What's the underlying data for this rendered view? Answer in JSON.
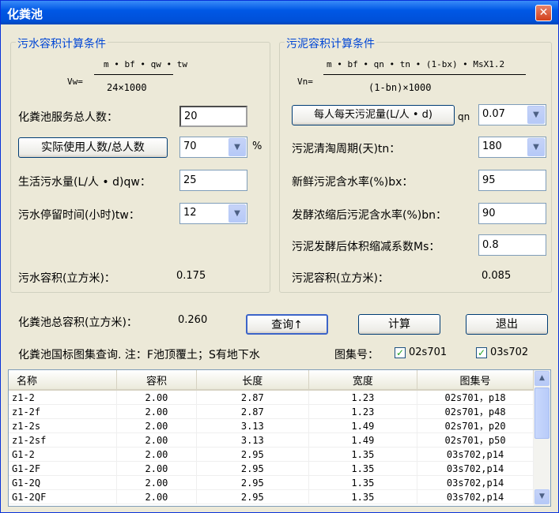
{
  "window": {
    "title": "化粪池",
    "close_label": "✕"
  },
  "sewage": {
    "group_title": "污水容积计算条件",
    "formula_lhs": "Vw=",
    "formula_num": "m • bf • qw • tw",
    "formula_den": "24×1000",
    "people_label": "化粪池服务总人数：",
    "people_value": "20",
    "ratio_button": "实际使用人数/总人数",
    "ratio_value": "70",
    "ratio_unit": "%",
    "qw_label": "生活污水量(L/人 • d)qw：",
    "qw_value": "25",
    "tw_label": "污水停留时间(小时)tw：",
    "tw_value": "12",
    "result_label": "污水容积(立方米)：",
    "result_value": "0.175"
  },
  "sludge": {
    "group_title": "污泥容积计算条件",
    "formula_lhs": "Vn=",
    "formula_num": "m • bf • qn • tn • (1-bx) • MsX1.2",
    "formula_den": "(1-bn)×1000",
    "qn_button": "每人每天污泥量(L/人 • d)",
    "qn_suffix": "qn",
    "qn_value": "0.07",
    "tn_label": "污泥清淘周期(天)tn：",
    "tn_value": "180",
    "bx_label": "新鲜污泥含水率(%)bx：",
    "bx_value": "95",
    "bn_label": "发酵浓缩后污泥含水率(%)bn：",
    "bn_value": "90",
    "ms_label": "污泥发酵后体积缩减系数Ms：",
    "ms_value": "0.8",
    "result_label": "污泥容积(立方米)：",
    "result_value": "0.085"
  },
  "total": {
    "label": "化粪池总容积(立方米)：",
    "value": "0.260"
  },
  "buttons": {
    "query": "查询↑",
    "calc": "计算",
    "exit": "退出"
  },
  "atlas": {
    "note": "化粪池国标图集查询. 注：F池顶覆土；S有地下水",
    "label": "图集号：",
    "options": [
      {
        "label": "02s701",
        "checked": true
      },
      {
        "label": "03s702",
        "checked": true
      }
    ]
  },
  "table": {
    "headers": [
      "名称",
      "容积",
      "长度",
      "宽度",
      "图集号"
    ],
    "rows": [
      [
        "z1-2",
        "2.00",
        "2.87",
        "1.23",
        "02s701，p18"
      ],
      [
        "z1-2f",
        "2.00",
        "2.87",
        "1.23",
        "02s701，p48"
      ],
      [
        "z1-2s",
        "2.00",
        "3.13",
        "1.49",
        "02s701，p20"
      ],
      [
        "z1-2sf",
        "2.00",
        "3.13",
        "1.49",
        "02s701，p50"
      ],
      [
        "G1-2",
        "2.00",
        "2.95",
        "1.35",
        "03s702,p14"
      ],
      [
        "G1-2F",
        "2.00",
        "2.95",
        "1.35",
        "03s702,p14"
      ],
      [
        "G1-2Q",
        "2.00",
        "2.95",
        "1.35",
        "03s702,p14"
      ],
      [
        "G1-2QF",
        "2.00",
        "2.95",
        "1.35",
        "03s702,p14"
      ]
    ]
  },
  "icons": {
    "dropdown": "chevron-down-icon",
    "scroll_up": "arrow-up-icon",
    "scroll_down": "arrow-down-icon"
  }
}
